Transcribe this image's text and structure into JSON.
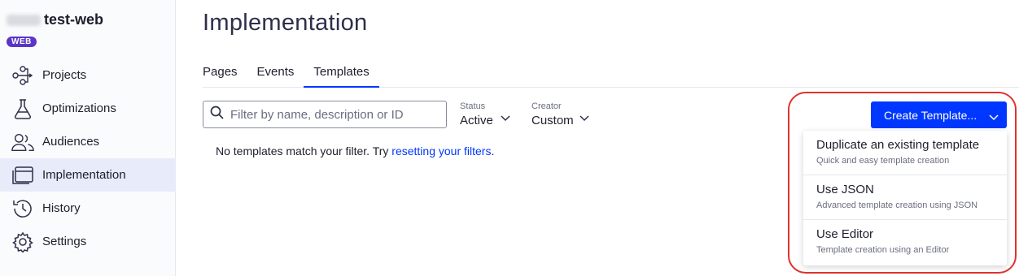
{
  "project": {
    "name": "test-web",
    "badge": "WEB"
  },
  "sidebar": {
    "items": [
      {
        "label": "Projects",
        "icon": "projects-icon"
      },
      {
        "label": "Optimizations",
        "icon": "flask-icon"
      },
      {
        "label": "Audiences",
        "icon": "users-icon"
      },
      {
        "label": "Implementation",
        "icon": "browser-window-icon",
        "active": true
      },
      {
        "label": "History",
        "icon": "history-icon"
      },
      {
        "label": "Settings",
        "icon": "gear-icon"
      }
    ]
  },
  "page": {
    "title": "Implementation"
  },
  "tabs": [
    {
      "label": "Pages"
    },
    {
      "label": "Events"
    },
    {
      "label": "Templates",
      "active": true
    }
  ],
  "search": {
    "placeholder": "Filter by name, description or ID"
  },
  "filters": {
    "status": {
      "label": "Status",
      "value": "Active"
    },
    "creator": {
      "label": "Creator",
      "value": "Custom"
    }
  },
  "empty_state": {
    "text": "No templates match your filter. Try ",
    "link": "resetting your filters",
    "suffix": "."
  },
  "create_button": {
    "label": "Create Template..."
  },
  "create_menu": [
    {
      "title": "Duplicate an existing template",
      "desc": "Quick and easy template creation"
    },
    {
      "title": "Use JSON",
      "desc": "Advanced template creation using JSON"
    },
    {
      "title": "Use Editor",
      "desc": "Template creation using an Editor"
    }
  ],
  "colors": {
    "accent": "#0037ff",
    "badge": "#5b36c6",
    "highlight": "#e0322f",
    "active_nav": "#e8ebfa"
  }
}
